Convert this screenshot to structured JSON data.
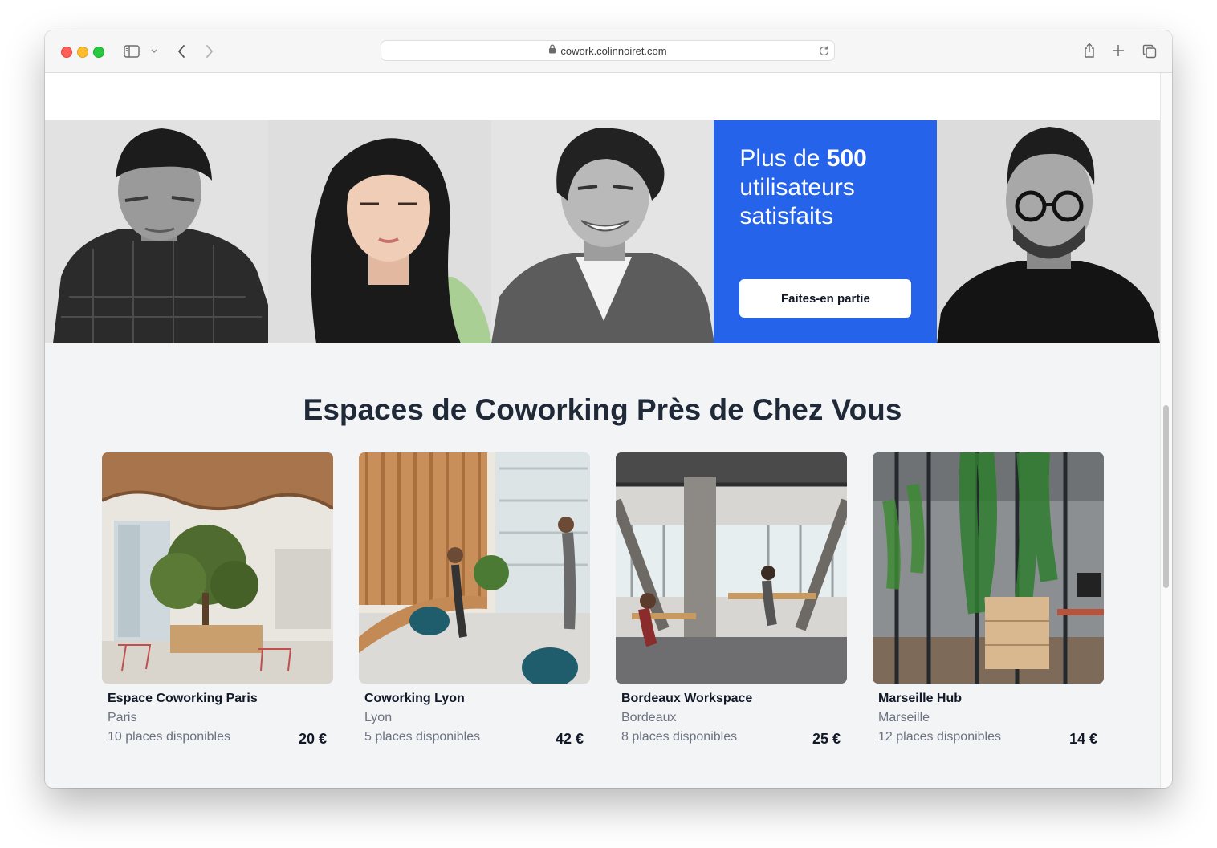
{
  "browser": {
    "url": "cowork.colinnoiret.com"
  },
  "promo": {
    "text_prefix": "Plus de ",
    "count": "500",
    "text_suffix": "utilisateurs satisfaits",
    "button_label": "Faites-en partie",
    "accent_color": "#2563eb"
  },
  "section": {
    "title": "Espaces de Coworking Près de Chez Vous"
  },
  "spaces": [
    {
      "name": "Espace Coworking Paris",
      "city": "Paris",
      "places": "10 places disponibles",
      "price": "20 €"
    },
    {
      "name": "Coworking Lyon",
      "city": "Lyon",
      "places": "5 places disponibles",
      "price": "42 €"
    },
    {
      "name": "Bordeaux Workspace",
      "city": "Bordeaux",
      "places": "8 places disponibles",
      "price": "25 €"
    },
    {
      "name": "Marseille Hub",
      "city": "Marseille",
      "places": "12 places disponibles",
      "price": "14 €"
    }
  ]
}
